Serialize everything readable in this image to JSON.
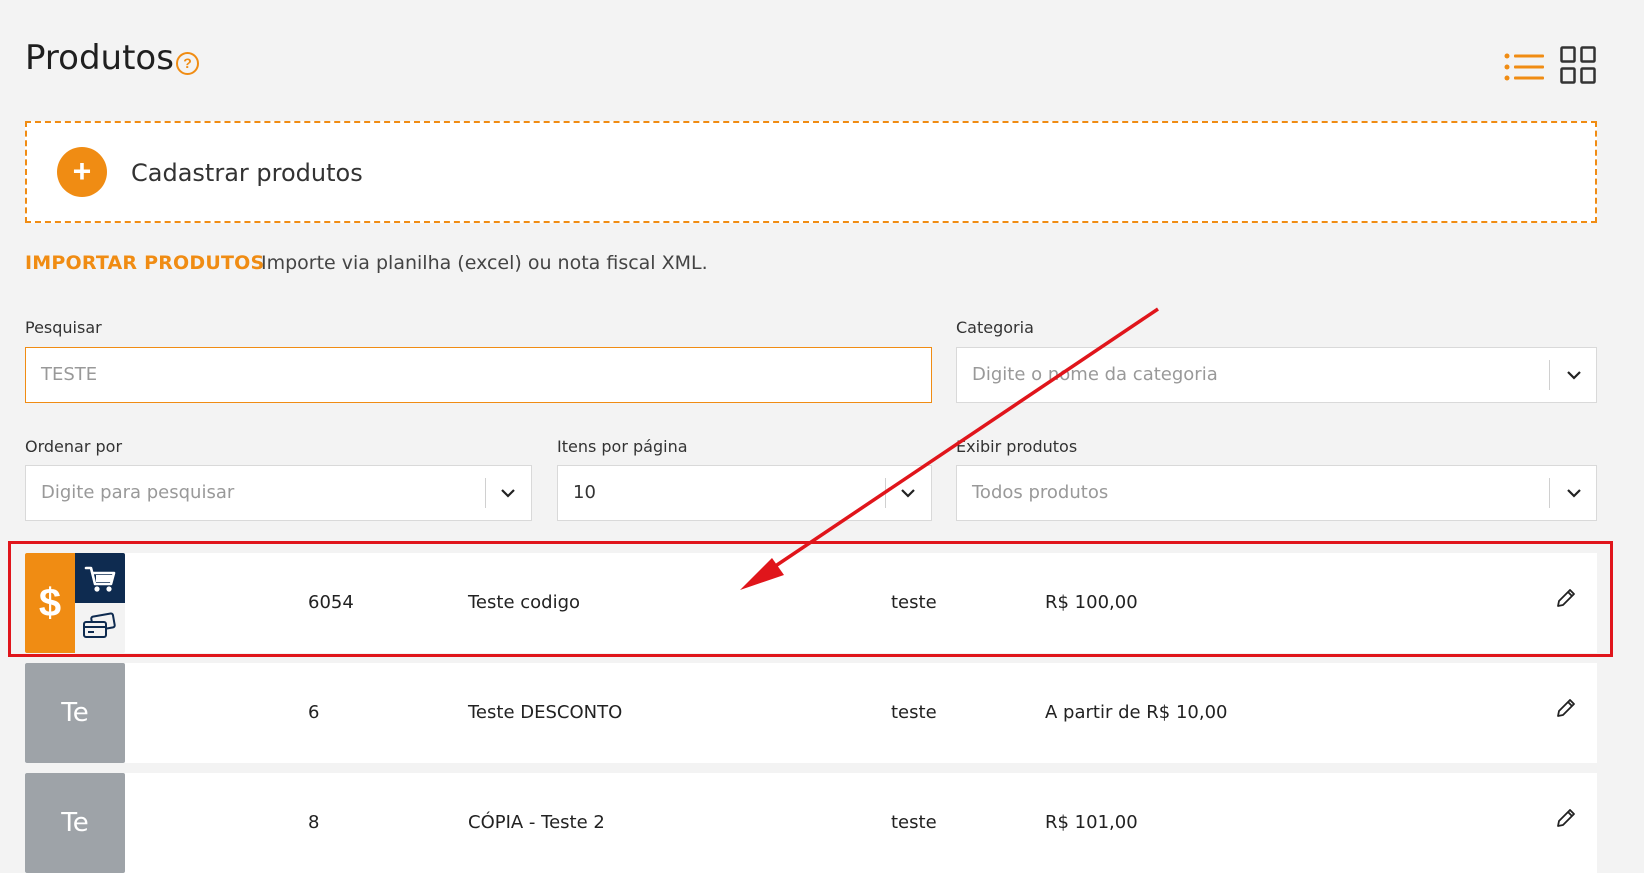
{
  "header": {
    "title": "Produtos",
    "help_glyph": "?"
  },
  "icons": {
    "help": "question-circle-icon",
    "list_view": "list-view-icon",
    "grid_view": "grid-view-icon",
    "add": "plus-circle-icon",
    "dropdown": "chevron-down-icon",
    "edit": "pencil-icon",
    "cart": "cart-icon",
    "card": "credit-card-icon",
    "dollar": "dollar-icon"
  },
  "register": {
    "plus_glyph": "+",
    "label": "Cadastrar produtos"
  },
  "import": {
    "link": "IMPORTAR PRODUTOS",
    "description": "Importe via planilha (excel) ou nota fiscal XML."
  },
  "filters": {
    "search_label": "Pesquisar",
    "search_value": "TESTE",
    "category_label": "Categoria",
    "category_placeholder": "Digite o nome da categoria",
    "order_label": "Ordenar por",
    "order_placeholder": "Digite para pesquisar",
    "items_label": "Itens por página",
    "items_value": "10",
    "display_label": "Exibir produtos",
    "display_value": "Todos produtos"
  },
  "products": [
    {
      "thumb": "",
      "dollar": "$",
      "code": "6054",
      "name": "Teste codigo",
      "category": "teste",
      "price": "R$ 100,00"
    },
    {
      "thumb": "Te",
      "code": "6",
      "name": "Teste DESCONTO",
      "category": "teste",
      "price": "A partir de R$ 10,00"
    },
    {
      "thumb": "Te",
      "code": "8",
      "name": "CÓPIA - Teste 2",
      "category": "teste",
      "price": "R$ 101,00"
    }
  ],
  "colors": {
    "accent": "#f08c13",
    "navy": "#0e2b50",
    "annotation_red": "#e0151b",
    "thumb_grey": "#9ea3a8"
  }
}
